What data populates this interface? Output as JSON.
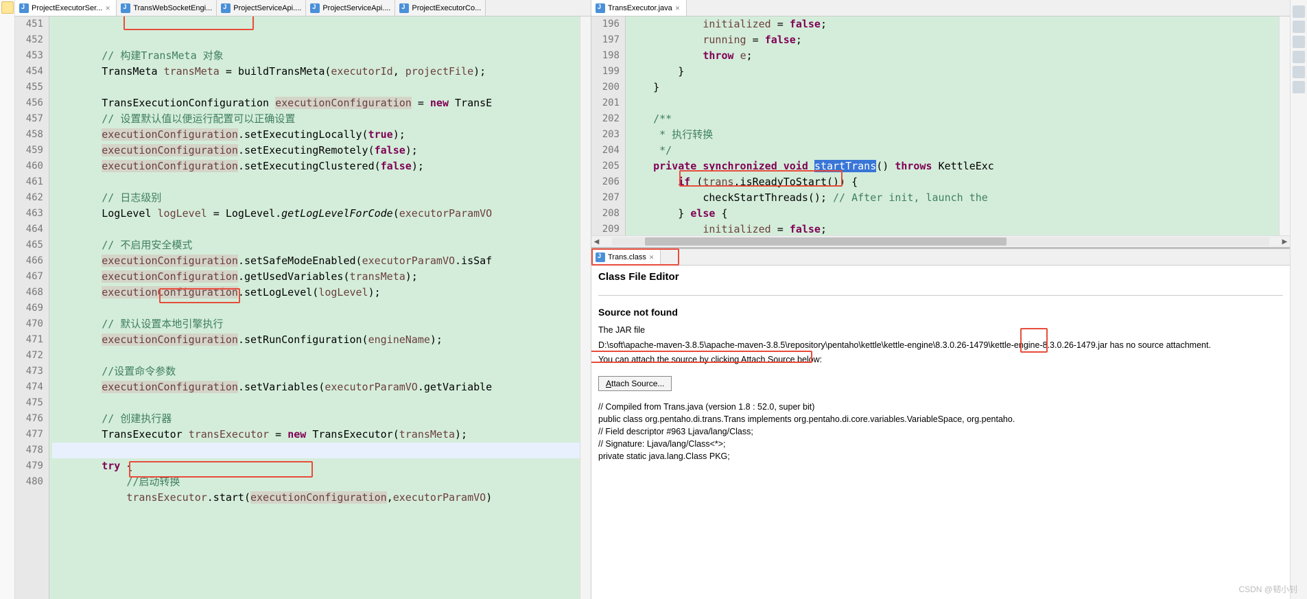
{
  "left_tabs": [
    {
      "label": "ProjectExecutorSer...",
      "active": true
    },
    {
      "label": "TransWebSocketEngi...",
      "active": false
    },
    {
      "label": "ProjectServiceApi....",
      "active": false
    },
    {
      "label": "ProjectServiceApi....",
      "active": false
    },
    {
      "label": "ProjectExecutorCo...",
      "active": false
    }
  ],
  "right_tabs": [
    {
      "label": "TransExecutor.java",
      "active": true
    }
  ],
  "bottom_tab": {
    "label": "Trans.class"
  },
  "left_code": {
    "start": 451,
    "lines": [
      {
        "n": 451,
        "t": "        // 构建TransMeta 对象",
        "cls": "c-comment"
      },
      {
        "n": 452,
        "t": "        TransMeta transMeta = buildTransMeta(executorId, projectFile);",
        "tokens": [
          [
            "TransMeta ",
            "c-type"
          ],
          [
            "transMeta",
            "c-var"
          ],
          [
            " = ",
            ""
          ],
          [
            "buildTransMeta",
            ""
          ],
          [
            "(",
            ""
          ],
          [
            "executorId",
            "c-var"
          ],
          [
            ", ",
            ""
          ],
          [
            "projectFile",
            "c-var"
          ],
          [
            ");",
            ""
          ]
        ]
      },
      {
        "n": 453,
        "t": ""
      },
      {
        "n": 454,
        "t": "        TransExecutionConfiguration executionConfiguration = new TransE",
        "tokens": [
          [
            "TransExecutionConfiguration ",
            "c-type"
          ],
          [
            "executionConfiguration",
            "c-var c-hl"
          ],
          [
            " = ",
            ""
          ],
          [
            "new ",
            "c-kw"
          ],
          [
            "TransE",
            ""
          ]
        ]
      },
      {
        "n": 455,
        "t": "        // 设置默认值以便运行配置可以正确设置",
        "cls": "c-comment"
      },
      {
        "n": 456,
        "t": "        executionConfiguration.setExecutingLocally(true);",
        "tokens": [
          [
            "executionConfiguration",
            "c-var c-hl"
          ],
          [
            ".setExecutingLocally(",
            ""
          ],
          [
            "true",
            "c-kw"
          ],
          [
            ");",
            ""
          ]
        ]
      },
      {
        "n": 457,
        "t": "        executionConfiguration.setExecutingRemotely(false);",
        "tokens": [
          [
            "executionConfiguration",
            "c-var c-hl"
          ],
          [
            ".setExecutingRemotely(",
            ""
          ],
          [
            "false",
            "c-kw"
          ],
          [
            ");",
            ""
          ]
        ]
      },
      {
        "n": 458,
        "t": "        executionConfiguration.setExecutingClustered(false);",
        "tokens": [
          [
            "executionConfiguration",
            "c-var c-hl"
          ],
          [
            ".setExecutingClustered(",
            ""
          ],
          [
            "false",
            "c-kw"
          ],
          [
            ");",
            ""
          ]
        ]
      },
      {
        "n": 459,
        "t": ""
      },
      {
        "n": 460,
        "t": "        // 日志级别",
        "cls": "c-comment"
      },
      {
        "n": 461,
        "t": "        LogLevel logLevel = LogLevel.getLogLevelForCode(executorParamVO",
        "tokens": [
          [
            "LogLevel ",
            "c-type"
          ],
          [
            "logLevel",
            "c-var"
          ],
          [
            " = LogLevel.",
            ""
          ],
          [
            "getLogLevelForCode",
            "c-ital"
          ],
          [
            "(",
            ""
          ],
          [
            "executorParamVO",
            "c-var"
          ]
        ]
      },
      {
        "n": 462,
        "t": ""
      },
      {
        "n": 463,
        "t": "        // 不启用安全模式",
        "cls": "c-comment"
      },
      {
        "n": 464,
        "t": "        executionConfiguration.setSafeModeEnabled(executorParamVO.isSaf",
        "tokens": [
          [
            "executionConfiguration",
            "c-var c-hl"
          ],
          [
            ".setSafeModeEnabled(",
            ""
          ],
          [
            "executorParamVO",
            "c-var"
          ],
          [
            ".isSaf",
            ""
          ]
        ]
      },
      {
        "n": 465,
        "t": "        executionConfiguration.getUsedVariables(transMeta);",
        "tokens": [
          [
            "executionConfiguration",
            "c-var c-hl"
          ],
          [
            ".getUsedVariables(",
            ""
          ],
          [
            "transMeta",
            "c-var"
          ],
          [
            ");",
            ""
          ]
        ]
      },
      {
        "n": 466,
        "t": "        executionConfiguration.setLogLevel(logLevel);",
        "tokens": [
          [
            "executionConfiguration",
            "c-var c-hl"
          ],
          [
            ".setLogLevel(",
            ""
          ],
          [
            "logLevel",
            "c-var"
          ],
          [
            ");",
            ""
          ]
        ]
      },
      {
        "n": 467,
        "t": ""
      },
      {
        "n": 468,
        "t": "        // 默认设置本地引擎执行",
        "cls": "c-comment"
      },
      {
        "n": 469,
        "t": "        executionConfiguration.setRunConfiguration(engineName);",
        "tokens": [
          [
            "executionConfiguration",
            "c-var c-hl"
          ],
          [
            ".setRunConfiguration(",
            ""
          ],
          [
            "engineName",
            "c-var"
          ],
          [
            ");",
            ""
          ]
        ]
      },
      {
        "n": 470,
        "t": ""
      },
      {
        "n": 471,
        "t": "        //设置命令参数",
        "cls": "c-comment"
      },
      {
        "n": 472,
        "t": "        executionConfiguration.setVariables(executorParamVO.getVariable",
        "tokens": [
          [
            "executionConfiguration",
            "c-var c-hl"
          ],
          [
            ".setVariables(",
            ""
          ],
          [
            "executorParamVO",
            "c-var"
          ],
          [
            ".getVariable",
            ""
          ]
        ]
      },
      {
        "n": 473,
        "t": ""
      },
      {
        "n": 474,
        "t": "        // 创建执行器",
        "cls": "c-comment"
      },
      {
        "n": 475,
        "t": "        TransExecutor transExecutor = new TransExecutor(transMeta);",
        "tokens": [
          [
            "TransExecutor ",
            "c-type"
          ],
          [
            "transExecutor",
            "c-var"
          ],
          [
            " = ",
            ""
          ],
          [
            "new ",
            "c-kw"
          ],
          [
            "TransExecutor(",
            ""
          ],
          [
            "transMeta",
            "c-var"
          ],
          [
            ");",
            ""
          ]
        ]
      },
      {
        "n": 476,
        "t": "",
        "cur": true
      },
      {
        "n": 477,
        "t": "        try {",
        "tokens": [
          [
            "try ",
            "c-kw"
          ],
          [
            "{",
            ""
          ]
        ]
      },
      {
        "n": 478,
        "t": "            //启动转换",
        "cls": "c-comment"
      },
      {
        "n": 479,
        "t": "            transExecutor.start(executionConfiguration,executorParamVO)",
        "tokens": [
          [
            "transExecutor",
            "c-var"
          ],
          [
            ".start(",
            ""
          ],
          [
            "executionConfiguration",
            "c-var c-hl"
          ],
          [
            ",",
            ""
          ],
          [
            "executorParamVO",
            "c-var"
          ],
          [
            ")",
            ""
          ]
        ]
      },
      {
        "n": 480,
        "t": ""
      }
    ]
  },
  "right_code": {
    "start": 196,
    "lines": [
      {
        "n": 196,
        "t": "            initialized = false;",
        "tokens": [
          [
            "initialized",
            "c-var"
          ],
          [
            " = ",
            ""
          ],
          [
            "false",
            "c-kw"
          ],
          [
            ";",
            ""
          ]
        ]
      },
      {
        "n": 197,
        "t": "            running = false;",
        "tokens": [
          [
            "running",
            "c-var"
          ],
          [
            " = ",
            ""
          ],
          [
            "false",
            "c-kw"
          ],
          [
            ";",
            ""
          ]
        ]
      },
      {
        "n": 198,
        "t": "            throw e;",
        "tokens": [
          [
            "throw ",
            "c-kw"
          ],
          [
            "e",
            "c-var"
          ],
          [
            ";",
            ""
          ]
        ]
      },
      {
        "n": 199,
        "t": "        }"
      },
      {
        "n": 200,
        "t": "    }"
      },
      {
        "n": 201,
        "t": ""
      },
      {
        "n": 202,
        "t": "    /**",
        "cls": "c-comment"
      },
      {
        "n": 203,
        "t": "     * 执行转换",
        "cls": "c-comment"
      },
      {
        "n": 204,
        "t": "     */",
        "cls": "c-comment"
      },
      {
        "n": 205,
        "t": "    private synchronized void startTrans() throws KettleExc",
        "tokens": [
          [
            "private synchronized void ",
            "c-kw"
          ],
          [
            "startTrans",
            "c-sel"
          ],
          [
            "() ",
            ""
          ],
          [
            "throws ",
            "c-kw"
          ],
          [
            "KettleExc",
            ""
          ]
        ]
      },
      {
        "n": 206,
        "t": "        if (trans.isReadyToStart()) {",
        "tokens": [
          [
            "if ",
            "c-kw"
          ],
          [
            "(",
            ""
          ],
          [
            "trans",
            "c-var"
          ],
          [
            ".isReadyToStart()",
            ""
          ],
          [
            ") {",
            ""
          ]
        ]
      },
      {
        "n": 207,
        "t": "            checkStartThreads(); // After init, launch the",
        "tokens": [
          [
            "checkStartThreads(); ",
            ""
          ],
          [
            "// After ",
            "c-comment"
          ],
          [
            "init",
            "c-comment"
          ],
          [
            ", launch the",
            "c-comment"
          ]
        ]
      },
      {
        "n": 208,
        "t": "        } else {",
        "tokens": [
          [
            "} ",
            ""
          ],
          [
            "else ",
            "c-kw"
          ],
          [
            "{",
            ""
          ]
        ]
      },
      {
        "n": 209,
        "t": "            initialized = false;",
        "tokens": [
          [
            "initialized",
            "c-var"
          ],
          [
            " = ",
            ""
          ],
          [
            "false",
            "c-kw"
          ],
          [
            ";",
            ""
          ]
        ]
      }
    ]
  },
  "classfile": {
    "title": "Class File Editor",
    "h3": "Source not found",
    "p1": "The JAR file",
    "path": "D:\\soft\\apache-maven-3.8.5\\apache-maven-3.8.5\\repository\\pentaho\\kettle\\kettle-engine\\8.3.0.26-1479\\kettle-engine-8.3.0.26-1479.jar has no source attachment.",
    "p2": "You can attach the source by clicking Attach Source below:",
    "button": "Attach Source...",
    "compiled": [
      "// Compiled from Trans.java (version 1.8 : 52.0, super bit)",
      "public class org.pentaho.di.trans.Trans implements org.pentaho.di.core.variables.VariableSpace, org.pentaho.",
      "",
      "  // Field descriptor #963 Ljava/lang/Class;",
      "  // Signature: Ljava/lang/Class<*>;",
      "  private static java.lang.Class PKG;"
    ]
  },
  "watermark": "CSDN @韧小钊"
}
